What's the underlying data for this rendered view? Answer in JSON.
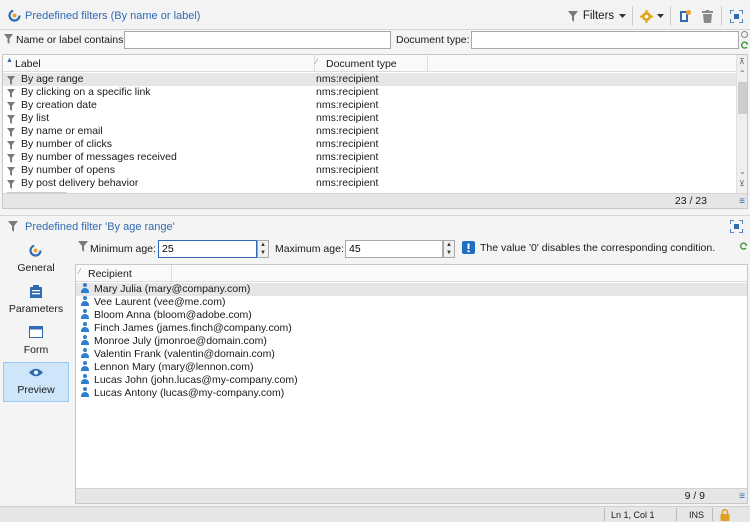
{
  "toolbar": {
    "title": "Predefined filters (By name or label)",
    "filters_label": "Filters"
  },
  "filter_bar": {
    "name_label": "Name or label contains:",
    "name_value": "",
    "doctype_label": "Document type:",
    "doctype_value": ""
  },
  "grid": {
    "col_label": "Label",
    "col_doctype": "Document type",
    "rows": [
      {
        "label": "By age range",
        "doctype": "nms:recipient"
      },
      {
        "label": "By clicking on a specific link",
        "doctype": "nms:recipient"
      },
      {
        "label": "By creation date",
        "doctype": "nms:recipient"
      },
      {
        "label": "By list",
        "doctype": "nms:recipient"
      },
      {
        "label": "By name or email",
        "doctype": "nms:recipient"
      },
      {
        "label": "By number of clicks",
        "doctype": "nms:recipient"
      },
      {
        "label": "By number of messages received",
        "doctype": "nms:recipient"
      },
      {
        "label": "By number of opens",
        "doctype": "nms:recipient"
      },
      {
        "label": "By post delivery behavior",
        "doctype": "nms:recipient"
      }
    ],
    "count": "23 / 23"
  },
  "detail": {
    "title": "Predefined filter 'By age range'"
  },
  "sidebar": {
    "items": [
      {
        "label": "General"
      },
      {
        "label": "Parameters"
      },
      {
        "label": "Form"
      },
      {
        "label": "Preview"
      }
    ]
  },
  "params": {
    "min_label": "Minimum age:",
    "min_value": "25",
    "max_label": "Maximum age:",
    "max_value": "45",
    "hint": "The value '0' disables the corresponding condition."
  },
  "recipients": {
    "col_label": "Recipient",
    "rows": [
      "Mary Julia (mary@company.com)",
      "Vee Laurent (vee@me.com)",
      "Bloom Anna (bloom@adobe.com)",
      "Finch James (james.finch@company.com)",
      "Monroe July (jmonroe@domain.com)",
      "Valentin Frank (valentin@domain.com)",
      "Lennon Mary (mary@lennon.com)",
      "Lucas John (john.lucas@my-company.com)",
      "Lucas Antony (lucas@my-company.com)"
    ],
    "count": "9 / 9"
  },
  "statusbar": {
    "position": "Ln 1, Col 1",
    "mode": "INS"
  },
  "colors": {
    "accent_blue": "#2f6bb3",
    "selection": "#e6e6e6",
    "active_sidebar": "#cfe5fa",
    "warning_blue": "#1f6fc5"
  }
}
